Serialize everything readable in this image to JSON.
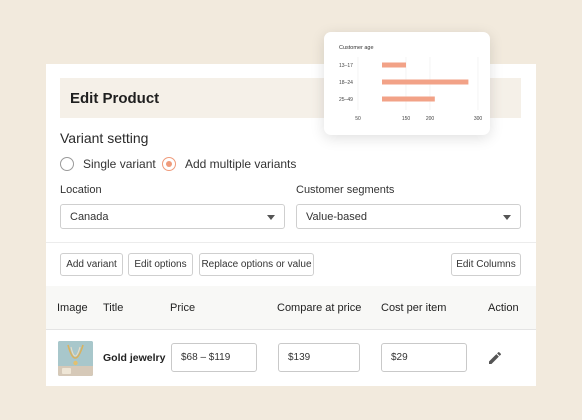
{
  "header": {
    "title": "Edit Product"
  },
  "variant_setting": {
    "title": "Variant setting",
    "options": [
      {
        "label": "Single variant",
        "selected": false
      },
      {
        "label": "Add multiple variants",
        "selected": true
      }
    ]
  },
  "location": {
    "label": "Location",
    "value": "Canada"
  },
  "segments": {
    "label": "Customer segments",
    "value": "Value-based"
  },
  "toolbar": {
    "add_variant": "Add variant",
    "edit_options": "Edit options",
    "replace_options": "Replace options or value",
    "edit_columns": "Edit Columns"
  },
  "table": {
    "columns": [
      "Image",
      "Title",
      "Price",
      "Compare at price",
      "Cost per item",
      "Action"
    ],
    "rows": [
      {
        "title": "Gold jewelry",
        "price": "$68 – $119",
        "compare_at": "$139",
        "cost": "$29",
        "action_icon": "pencil-icon"
      }
    ]
  },
  "colors": {
    "accent": "#ef9b7b",
    "background": "#f2eadd",
    "bar": "#f2a287"
  },
  "chart_data": {
    "type": "bar",
    "orientation": "horizontal",
    "title": "Customer age",
    "categories": [
      "13–17",
      "18–24",
      "25–49"
    ],
    "values": [
      150,
      280,
      210
    ],
    "x_ticks": [
      "50",
      "150",
      "200",
      "300"
    ],
    "x_tick_values": [
      50,
      150,
      200,
      300
    ],
    "xlim": [
      50,
      300
    ],
    "bar_start": 100,
    "grid": true
  }
}
